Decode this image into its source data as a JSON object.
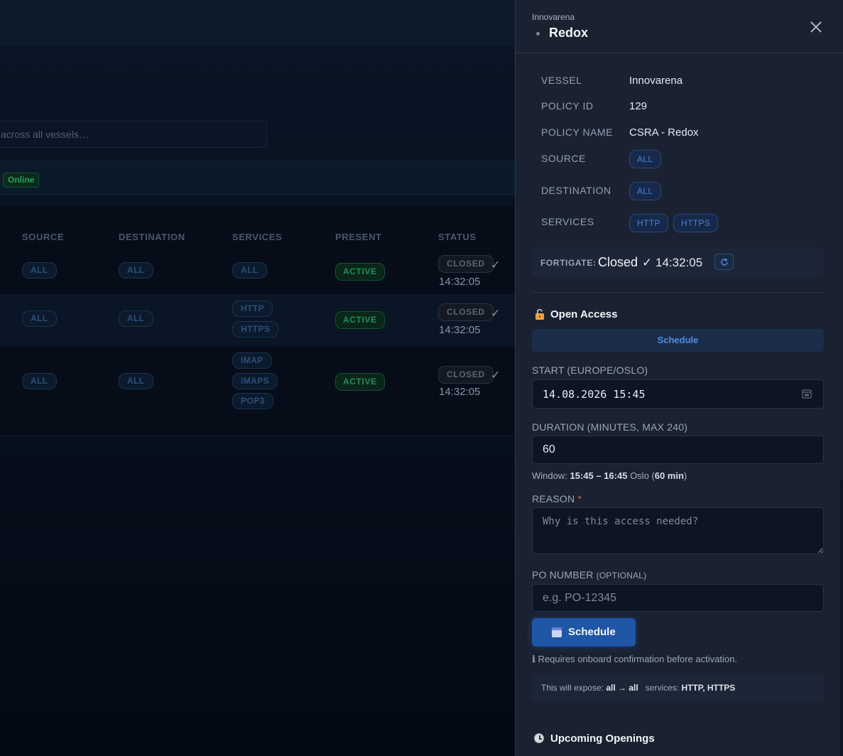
{
  "background": {
    "search_placeholder": "across all vessels…",
    "online_badge": "Online",
    "columns": [
      "SOURCE",
      "DESTINATION",
      "SERVICES",
      "PRESENT",
      "STATUS"
    ],
    "rows": [
      {
        "source": "ALL",
        "destination": "ALL",
        "services": [
          "ALL"
        ],
        "present": "ACTIVE",
        "status": "CLOSED",
        "check": "✓",
        "time": "14:32:05"
      },
      {
        "source": "ALL",
        "destination": "ALL",
        "services": [
          "HTTP",
          "HTTPS"
        ],
        "present": "ACTIVE",
        "status": "CLOSED",
        "check": "✓",
        "time": "14:32:05"
      },
      {
        "source": "ALL",
        "destination": "ALL",
        "services": [
          "IMAP",
          "IMAPS",
          "POP3"
        ],
        "present": "ACTIVE",
        "status": "CLOSED",
        "check": "✓",
        "time": "14:32:05"
      }
    ]
  },
  "panel": {
    "org": "Innovarena",
    "title": "Redox",
    "details": {
      "vessel_label": "VESSEL",
      "vessel": "Innovarena",
      "policy_id_label": "POLICY ID",
      "policy_id": "129",
      "policy_name_label": "POLICY NAME",
      "policy_name": "CSRA - Redox",
      "source_label": "SOURCE",
      "source": "ALL",
      "destination_label": "DESTINATION",
      "destination": "ALL",
      "services_label": "SERVICES",
      "services": [
        "HTTP",
        "HTTPS"
      ]
    },
    "fortigate": {
      "label": "FORTIGATE:",
      "status": "Closed",
      "check": "✓",
      "time": "14:32:05"
    },
    "open_access": {
      "title": "Open Access",
      "tab": "Schedule",
      "start_label": "START (EUROPE/OSLO)",
      "start_value": "14.08.2026 15:45",
      "duration_label": "DURATION (MINUTES, MAX 240)",
      "duration_value": "60",
      "window_prefix": "Window:",
      "window_range": "15:45 – 16:45",
      "window_tz": "Oslo (",
      "window_minutes": "60 min",
      "window_suffix": ")",
      "reason_label": "REASON",
      "reason_required": "*",
      "reason_placeholder": "Why is this access needed?",
      "po_label": "PO NUMBER",
      "po_optional": "(OPTIONAL)",
      "po_placeholder": "e.g. PO-12345",
      "schedule_button": "Schedule",
      "confirm_note": "ℹ Requires onboard confirmation before activation.",
      "expose_prefix": "This will expose:",
      "expose_route": "all → all",
      "expose_services_label": "services:",
      "expose_services": "HTTP, HTTPS"
    },
    "upcoming_title": "Upcoming Openings"
  }
}
